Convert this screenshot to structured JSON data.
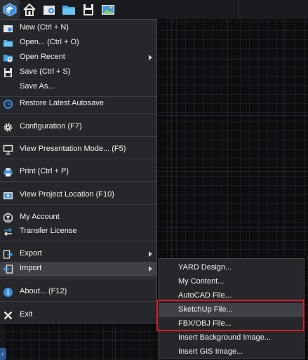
{
  "toolbar": {
    "icons": [
      "app-logo-icon",
      "home-icon",
      "new-project-icon",
      "folder-icon",
      "save-icon",
      "image-icon"
    ]
  },
  "menu": {
    "items": [
      {
        "label": "New (Ctrl + N)",
        "icon": "new-file-icon"
      },
      {
        "label": "Open... (Ctrl + O)",
        "icon": "open-folder-icon"
      },
      {
        "label": "Open Recent",
        "icon": "recent-icon",
        "submenu": true
      },
      {
        "label": "Save (Ctrl + S)",
        "icon": "save-icon"
      },
      {
        "label": "Save As..."
      },
      {
        "label": "Restore Latest Autosave",
        "icon": "restore-icon"
      },
      {
        "label": "Configuration (F7)",
        "icon": "gear-icon"
      },
      {
        "label": "View Presentation Mode... (F5)",
        "icon": "presentation-icon"
      },
      {
        "label": "Print (Ctrl + P)",
        "icon": "printer-icon"
      },
      {
        "label": "View Project Location (F10)",
        "icon": "location-icon"
      },
      {
        "label": "My Account",
        "icon": "account-icon"
      },
      {
        "label": "Transfer License",
        "icon": "transfer-icon"
      },
      {
        "label": "Export",
        "icon": "export-icon",
        "submenu": true
      },
      {
        "label": "Import",
        "icon": "import-icon",
        "submenu": true,
        "highlighted": true
      },
      {
        "label": "About... (F12)",
        "icon": "info-icon"
      },
      {
        "label": "Exit",
        "icon": "close-icon"
      }
    ]
  },
  "import_submenu": {
    "items": [
      {
        "label": "YARD Design..."
      },
      {
        "label": "My Content..."
      },
      {
        "label": "AutoCAD File..."
      },
      {
        "label": "SketchUp File...",
        "highlighted": true
      },
      {
        "label": "FBX/OBJ File..."
      },
      {
        "label": "Insert Background Image..."
      },
      {
        "label": "Insert GIS Image..."
      }
    ]
  },
  "colors": {
    "menu_bg": "#26272b",
    "highlight": "#3f4147",
    "annotation_box": "#d6202a",
    "icon_blue": "#3d8fdc"
  }
}
